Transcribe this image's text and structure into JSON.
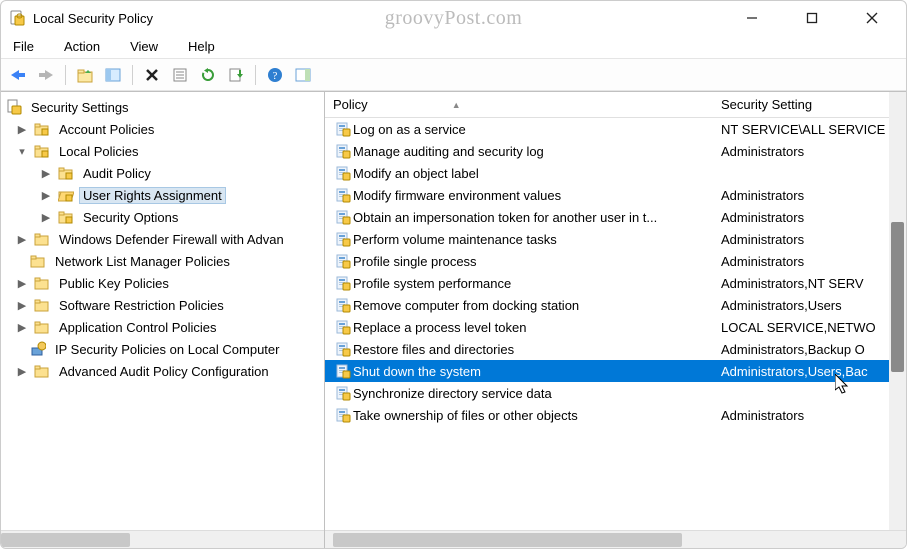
{
  "window": {
    "title": "Local Security Policy",
    "watermark": "groovyPost.com"
  },
  "menu": {
    "file": "File",
    "action": "Action",
    "view": "View",
    "help": "Help"
  },
  "tree": {
    "root": "Security Settings",
    "items": [
      {
        "label": "Account Policies"
      },
      {
        "label": "Local Policies"
      },
      {
        "label": "Audit Policy"
      },
      {
        "label": "User Rights Assignment"
      },
      {
        "label": "Security Options"
      },
      {
        "label": "Windows Defender Firewall with Advan"
      },
      {
        "label": "Network List Manager Policies"
      },
      {
        "label": "Public Key Policies"
      },
      {
        "label": "Software Restriction Policies"
      },
      {
        "label": "Application Control Policies"
      },
      {
        "label": "IP Security Policies on Local Computer"
      },
      {
        "label": "Advanced Audit Policy Configuration"
      }
    ]
  },
  "list": {
    "header": {
      "policy": "Policy",
      "setting": "Security Setting"
    },
    "rows": [
      {
        "policy": "Log on as a service",
        "setting": "NT SERVICE\\ALL SERVICE"
      },
      {
        "policy": "Manage auditing and security log",
        "setting": "Administrators"
      },
      {
        "policy": "Modify an object label",
        "setting": ""
      },
      {
        "policy": "Modify firmware environment values",
        "setting": "Administrators"
      },
      {
        "policy": "Obtain an impersonation token for another user in t...",
        "setting": "Administrators"
      },
      {
        "policy": "Perform volume maintenance tasks",
        "setting": "Administrators"
      },
      {
        "policy": "Profile single process",
        "setting": "Administrators"
      },
      {
        "policy": "Profile system performance",
        "setting": "Administrators,NT SERV"
      },
      {
        "policy": "Remove computer from docking station",
        "setting": "Administrators,Users"
      },
      {
        "policy": "Replace a process level token",
        "setting": "LOCAL SERVICE,NETWO"
      },
      {
        "policy": "Restore files and directories",
        "setting": "Administrators,Backup O"
      },
      {
        "policy": "Shut down the system",
        "setting": "Administrators,Users,Bac"
      },
      {
        "policy": "Synchronize directory service data",
        "setting": ""
      },
      {
        "policy": "Take ownership of files or other objects",
        "setting": "Administrators"
      }
    ]
  }
}
